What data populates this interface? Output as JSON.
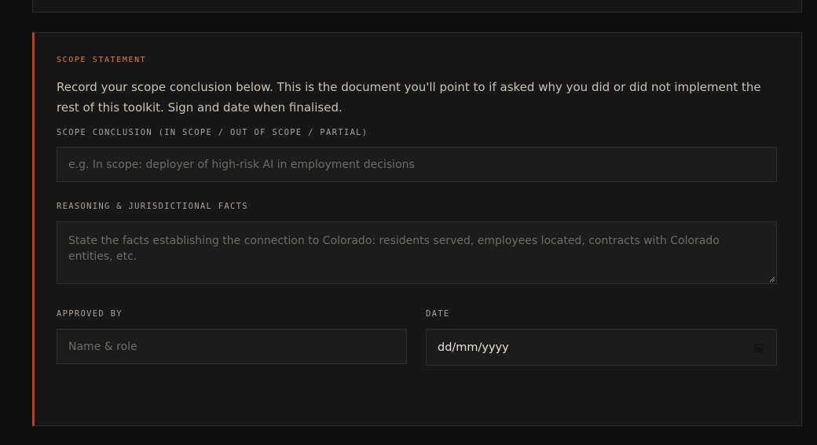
{
  "section": {
    "eyebrow": "SCOPE STATEMENT",
    "intro": "Record your scope conclusion below. This is the document you'll point to if asked why you did or did not implement the rest of this toolkit. Sign and date when finalised."
  },
  "fields": {
    "scope_conclusion": {
      "label": "SCOPE CONCLUSION (IN SCOPE / OUT OF SCOPE / PARTIAL)",
      "placeholder": "e.g. In scope: deployer of high-risk AI in employment decisions",
      "value": ""
    },
    "reasoning": {
      "label": "REASONING & JURISDICTIONAL FACTS",
      "placeholder": "State the facts establishing the connection to Colorado: residents served, employees located, contracts with Colorado entities, etc.",
      "value": ""
    },
    "approved_by": {
      "label": "APPROVED BY",
      "placeholder": "Name & role",
      "value": ""
    },
    "date": {
      "label": "DATE",
      "value": "dd/mm/yyyy",
      "icon": "calendar-icon"
    }
  },
  "colors": {
    "accent": "#c2410c",
    "eyebrow": "#e07a44",
    "background": "#0f0f0f",
    "card": "#171717"
  }
}
